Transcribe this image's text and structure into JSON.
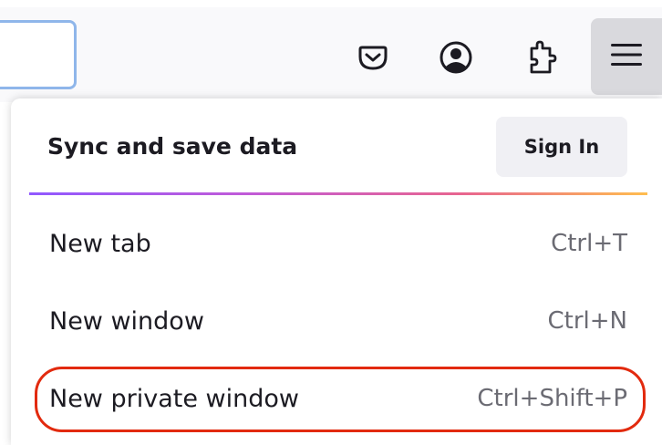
{
  "toolbar": {
    "icons": [
      "pocket-icon",
      "account-icon",
      "extensions-icon",
      "hamburger-menu-icon"
    ]
  },
  "sync": {
    "title": "Sync and save data",
    "sign_in_label": "Sign In"
  },
  "menu": {
    "items": [
      {
        "label": "New tab",
        "shortcut": "Ctrl+T"
      },
      {
        "label": "New window",
        "shortcut": "Ctrl+N"
      },
      {
        "label": "New private window",
        "shortcut": "Ctrl+Shift+P"
      }
    ]
  },
  "colors": {
    "highlight": "#e22a0e",
    "menu_button_bg": "#d9d9dd",
    "gradient": [
      "#9059ff",
      "#c05ad8",
      "#e8658f",
      "#ffbd4f"
    ]
  }
}
